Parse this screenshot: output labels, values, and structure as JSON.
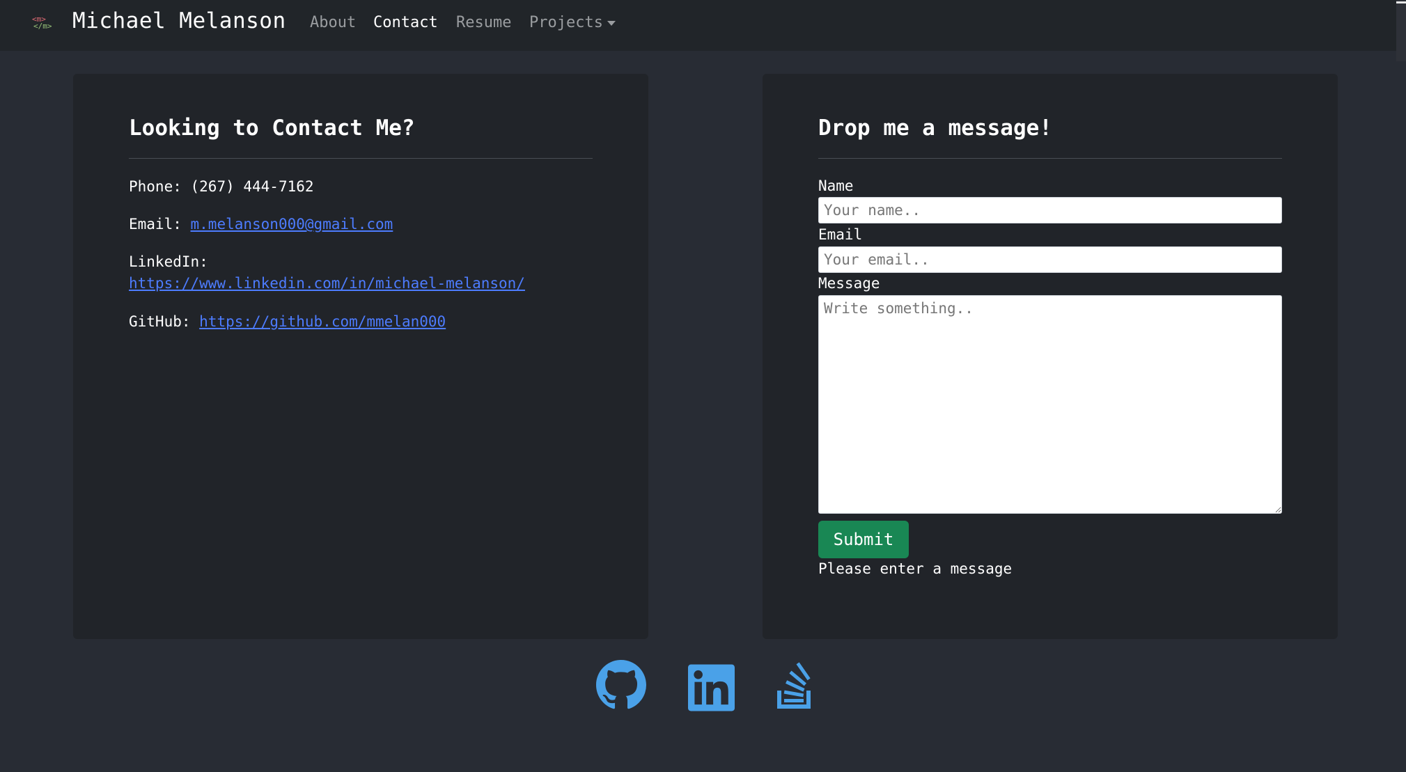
{
  "nav": {
    "brand": "Michael Melanson",
    "logo_text": "</m>",
    "links": [
      {
        "label": "About"
      },
      {
        "label": "Contact"
      },
      {
        "label": "Resume"
      },
      {
        "label": "Projects"
      }
    ],
    "active": "Contact"
  },
  "contact_card": {
    "title": "Looking to Contact Me?",
    "phone_label": "Phone:",
    "phone_value": "(267) 444-7162",
    "email_label": "Email:",
    "email_value": "m.melanson000@gmail.com",
    "linkedin_label": "LinkedIn:",
    "linkedin_value": "https://www.linkedin.com/in/michael-melanson/",
    "github_label": "GitHub:",
    "github_value": "https://github.com/mmelan000"
  },
  "message_card": {
    "title": "Drop me a message!",
    "name_label": "Name",
    "name_placeholder": "Your name..",
    "email_label": "Email",
    "email_placeholder": "Your email..",
    "message_label": "Message",
    "message_placeholder": "Write something..",
    "submit_label": "Submit",
    "status": "Please enter a message"
  },
  "footer": {
    "icons": [
      "github-icon",
      "linkedin-icon",
      "stackoverflow-icon"
    ],
    "icon_color": "#4aa1e8"
  },
  "colors": {
    "page_bg": "#282c34",
    "navbar_bg": "#212529",
    "card_bg": "#212429",
    "link": "#4d7cff",
    "submit_bg": "#198754"
  }
}
